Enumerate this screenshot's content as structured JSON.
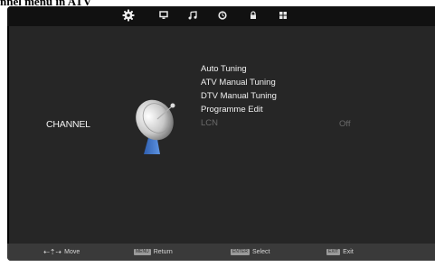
{
  "caption": "nnel menu in ATV",
  "topbar": {
    "icons": [
      "gear-icon",
      "picture-icon",
      "music-note-icon",
      "clock-icon",
      "lock-icon",
      "grid-icon"
    ],
    "active_color": "#f0f0f0"
  },
  "channel": {
    "title": "CHANNEL",
    "menu_items": [
      {
        "label": "Auto Tuning",
        "enabled": true
      },
      {
        "label": "ATV Manual Tuning",
        "enabled": true
      },
      {
        "label": "DTV Manual Tuning",
        "enabled": true
      },
      {
        "label": "Programme Edit",
        "enabled": true
      },
      {
        "label": "LCN",
        "enabled": false,
        "value": "Off"
      }
    ]
  },
  "bottom_hints": {
    "move": "Move",
    "return_key": "MENU",
    "return": "Return",
    "select_key": "ENTER",
    "select": "Select",
    "exit_key": "EXIT",
    "exit": "Exit"
  },
  "colors": {
    "frame": "#000000",
    "panel": "#262626",
    "bottom_bar": "#3a3a3a",
    "disabled_text": "#6a6a6a"
  }
}
